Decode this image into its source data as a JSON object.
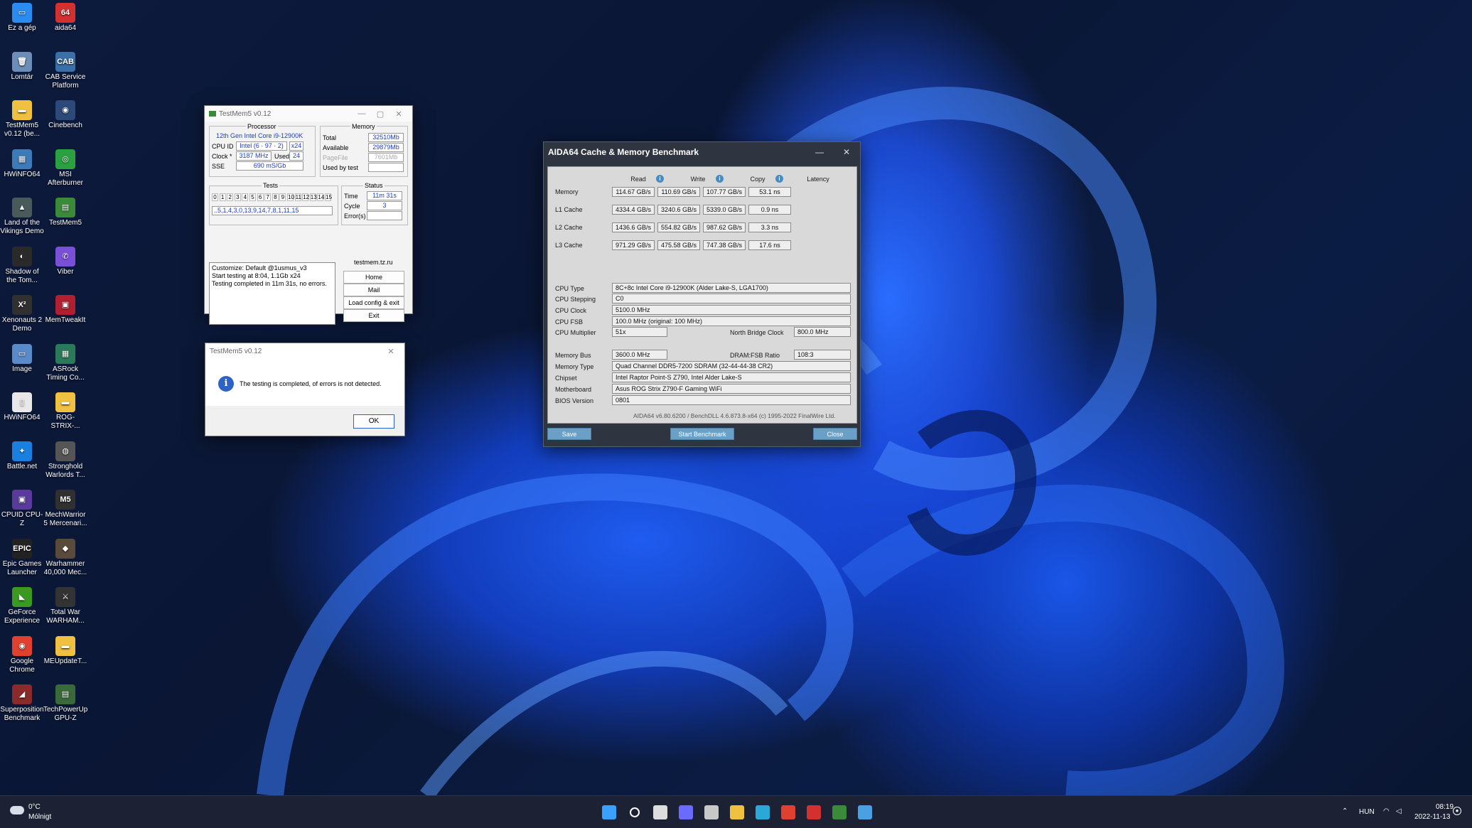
{
  "desktop": {
    "icons": [
      {
        "label": "Ez a gép",
        "color": "#2a8cf0",
        "glyph": "▭"
      },
      {
        "label": "aida64",
        "color": "#d43030",
        "glyph": "64"
      },
      {
        "label": "Lomtár",
        "color": "#6c8db8",
        "glyph": "🗑"
      },
      {
        "label": "CAB Service Platform",
        "color": "#3a6fa8",
        "glyph": "CAB"
      },
      {
        "label": "TestMem5 v0.12 (be...",
        "color": "#f0c040",
        "glyph": "▬"
      },
      {
        "label": "Cinebench",
        "color": "#2b4a7a",
        "glyph": "◉"
      },
      {
        "label": "HWiNFO64",
        "color": "#3c7ab8",
        "glyph": "▦"
      },
      {
        "label": "MSI Afterburner",
        "color": "#2aa040",
        "glyph": "◎"
      },
      {
        "label": "Land of the Vikings Demo",
        "color": "#4a5a5a",
        "glyph": "▲"
      },
      {
        "label": "TestMem5",
        "color": "#3a8a3a",
        "glyph": "▤"
      },
      {
        "label": "Shadow of the Tom...",
        "color": "#2a2a2a",
        "glyph": "◐"
      },
      {
        "label": "Viber",
        "color": "#7a50d8",
        "glyph": "✆"
      },
      {
        "label": "Xenonauts 2 Demo",
        "color": "#303030",
        "glyph": "X²"
      },
      {
        "label": "MemTweakIt",
        "color": "#b02030",
        "glyph": "▣"
      },
      {
        "label": "Image",
        "color": "#5a8ac8",
        "glyph": "▭"
      },
      {
        "label": "ASRock Timing Co...",
        "color": "#2a7a5a",
        "glyph": "▦"
      },
      {
        "label": "HWiNFO64",
        "color": "#e8e8e8",
        "glyph": "▯"
      },
      {
        "label": "ROG-STRIX-...",
        "color": "#f0c040",
        "glyph": "▬"
      },
      {
        "label": "Battle.net",
        "color": "#1a80e0",
        "glyph": "✦"
      },
      {
        "label": "Stronghold Warlords T...",
        "color": "#555",
        "glyph": "◍"
      },
      {
        "label": "CPUID CPU-Z",
        "color": "#5a3a9a",
        "glyph": "▣"
      },
      {
        "label": "MechWarrior 5 Mercenari...",
        "color": "#303030",
        "glyph": "M5"
      },
      {
        "label": "Epic Games Launcher",
        "color": "#222",
        "glyph": "EPIC"
      },
      {
        "label": "Warhammer 40,000 Mec...",
        "color": "#5a4a3a",
        "glyph": "◆"
      },
      {
        "label": "GeForce Experience",
        "color": "#3a9a20",
        "glyph": "◣"
      },
      {
        "label": "Total War WARHAM...",
        "color": "#333",
        "glyph": "⚔"
      },
      {
        "label": "Google Chrome",
        "color": "#e04030",
        "glyph": "◉"
      },
      {
        "label": "MEUpdateT...",
        "color": "#f0c040",
        "glyph": "▬"
      },
      {
        "label": "Superposition Benchmark",
        "color": "#8a2a2a",
        "glyph": "◢"
      },
      {
        "label": "TechPowerUp GPU-Z",
        "color": "#3a6a3a",
        "glyph": "▤"
      }
    ]
  },
  "testmem": {
    "title": "TestMem5 v0.12",
    "processor_header": "Processor",
    "processor_name": "12th Gen Intel Core i9-12900K",
    "cpu_id_label": "CPU ID",
    "cpu_id_value": "Intel  (6 · 97 · 2)",
    "cpu_threads": "x24",
    "clock_label": "Clock *",
    "clock_value": "3187 MHz",
    "used_label": "Used",
    "used_value": "24",
    "sse_label": "SSE",
    "sse_value": "690 mS/Gb",
    "memory_header": "Memory",
    "total_label": "Total",
    "total_value": "32510Mb",
    "available_label": "Available",
    "available_value": "29879Mb",
    "pagefile_label": "PageFile",
    "pagefile_value": "7601Mb",
    "usedbytest_label": "Used by test",
    "usedbytest_value": "",
    "tests_header": "Tests",
    "test_cells": [
      "0",
      "1",
      "2",
      "3",
      "4",
      "5",
      "6",
      "7",
      "8",
      "9",
      "10",
      "11",
      "12",
      "13",
      "14",
      "15"
    ],
    "test_sequence": "..5,1,4,3,0,13,9,14,7,8,1,11,15",
    "status_header": "Status",
    "time_label": "Time",
    "time_value": "11m 31s",
    "cycle_label": "Cycle",
    "cycle_value": "3",
    "errors_label": "Error(s)",
    "errors_value": "",
    "log_lines": [
      "Customize: Default @1usmus_v3",
      "Start testing at 8:04, 1.1Gb x24",
      "Testing completed in 11m 31s, no errors."
    ],
    "site": "testmem.tz.ru",
    "btn_home": "Home",
    "btn_mail": "Mail",
    "btn_load": "Load config & exit",
    "btn_exit": "Exit"
  },
  "dialog": {
    "title": "TestMem5 v0.12",
    "message": "The testing is completed, of errors is not detected.",
    "ok": "OK"
  },
  "aida": {
    "title": "AIDA64 Cache & Memory Benchmark",
    "headers": {
      "read": "Read",
      "write": "Write",
      "copy": "Copy",
      "latency": "Latency"
    },
    "rows": [
      {
        "label": "Memory",
        "read": "114.67 GB/s",
        "write": "110.69 GB/s",
        "copy": "107.77 GB/s",
        "latency": "53.1 ns"
      },
      {
        "label": "L1 Cache",
        "read": "4334.4 GB/s",
        "write": "3240.6 GB/s",
        "copy": "5339.0 GB/s",
        "latency": "0.9 ns"
      },
      {
        "label": "L2 Cache",
        "read": "1436.6 GB/s",
        "write": "554.82 GB/s",
        "copy": "987.62 GB/s",
        "latency": "3.3 ns"
      },
      {
        "label": "L3 Cache",
        "read": "971.29 GB/s",
        "write": "475.58 GB/s",
        "copy": "747.38 GB/s",
        "latency": "17.6 ns"
      }
    ],
    "cpu_type_label": "CPU Type",
    "cpu_type": "8C+8c Intel Core i9-12900K  (Alder Lake-S, LGA1700)",
    "cpu_stepping_label": "CPU Stepping",
    "cpu_stepping": "C0",
    "cpu_clock_label": "CPU Clock",
    "cpu_clock": "5100.0 MHz",
    "cpu_fsb_label": "CPU FSB",
    "cpu_fsb": "100.0 MHz  (original: 100 MHz)",
    "cpu_mult_label": "CPU Multiplier",
    "cpu_mult": "51x",
    "nb_clock_label": "North Bridge Clock",
    "nb_clock": "800.0 MHz",
    "mem_bus_label": "Memory Bus",
    "mem_bus": "3600.0 MHz",
    "dram_ratio_label": "DRAM:FSB Ratio",
    "dram_ratio": "108:3",
    "mem_type_label": "Memory Type",
    "mem_type": "Quad Channel DDR5-7200 SDRAM  (32-44-44-38 CR2)",
    "chipset_label": "Chipset",
    "chipset": "Intel Raptor Point-S Z790, Intel Alder Lake-S",
    "mobo_label": "Motherboard",
    "mobo": "Asus ROG Strix Z790-F Gaming WiFi",
    "bios_label": "BIOS Version",
    "bios": "0801",
    "footer": "AIDA64 v6.80.6200 / BenchDLL 4.6.873.8-x64  (c) 1995-2022 FinalWire Ltd.",
    "btn_save": "Save",
    "btn_start": "Start Benchmark",
    "btn_close": "Close"
  },
  "taskbar": {
    "weather_temp": "0°C",
    "weather_desc": "Mólnigt",
    "lang": "HUN",
    "time": "08:19",
    "date": "2022-11-13",
    "apps": [
      {
        "name": "start-icon",
        "color": "#3aa0ff"
      },
      {
        "name": "search-icon",
        "color": "#ffffff"
      },
      {
        "name": "task-view-icon",
        "color": "#dddddd"
      },
      {
        "name": "chat-icon",
        "color": "#6a6aff"
      },
      {
        "name": "calculator-icon",
        "color": "#c8c8c8"
      },
      {
        "name": "file-explorer-icon",
        "color": "#f0c040"
      },
      {
        "name": "edge-icon",
        "color": "#2aa8d8"
      },
      {
        "name": "chrome-icon",
        "color": "#e04030"
      },
      {
        "name": "aida64-icon",
        "color": "#d43030"
      },
      {
        "name": "testmem5-icon",
        "color": "#3a8a3a"
      },
      {
        "name": "app-icon",
        "color": "#4aa0e0"
      }
    ]
  }
}
